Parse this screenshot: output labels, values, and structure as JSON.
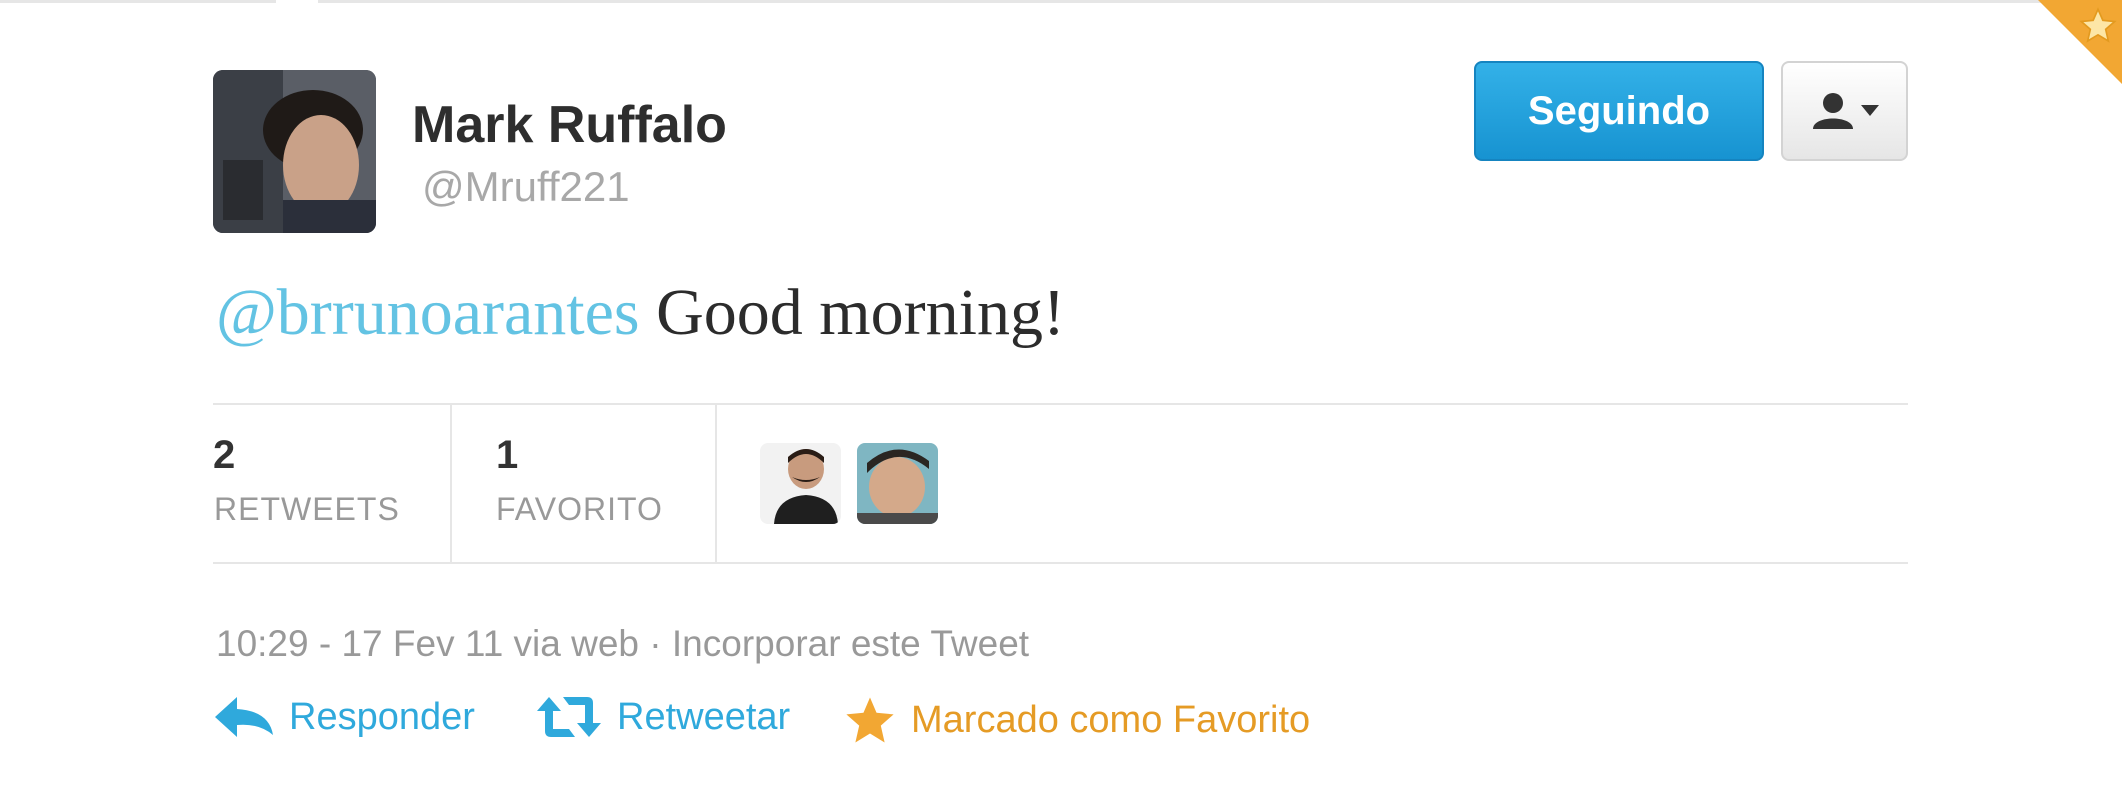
{
  "user": {
    "name": "Mark Ruffalo",
    "handle": "@Mruff221"
  },
  "follow_button": {
    "label": "Seguindo"
  },
  "tweet": {
    "mention": "@brrunoarantes",
    "text": " Good morning!"
  },
  "stats": {
    "retweets": {
      "count": "2",
      "label": "RETWEETS"
    },
    "favorites": {
      "count": "1",
      "label": "FAVORITO"
    }
  },
  "meta": {
    "timestamp": "10:29 - 17 Fev 11 via web",
    "separator": " · ",
    "embed_link": "Incorporar este Tweet"
  },
  "actions": {
    "reply": "Responder",
    "retweet": "Retweetar",
    "favorite": "Marcado como Favorito"
  },
  "colors": {
    "accent_blue": "#2fa9dc",
    "mention_blue": "#63c3e3",
    "favorite_orange": "#e59b25",
    "follow_button": "#1793d1"
  },
  "icons": {
    "reply": "reply-arrow-icon",
    "retweet": "retweet-icon",
    "favorite": "star-icon",
    "user_menu": "user-icon",
    "menu_caret": "caret-down-icon"
  }
}
